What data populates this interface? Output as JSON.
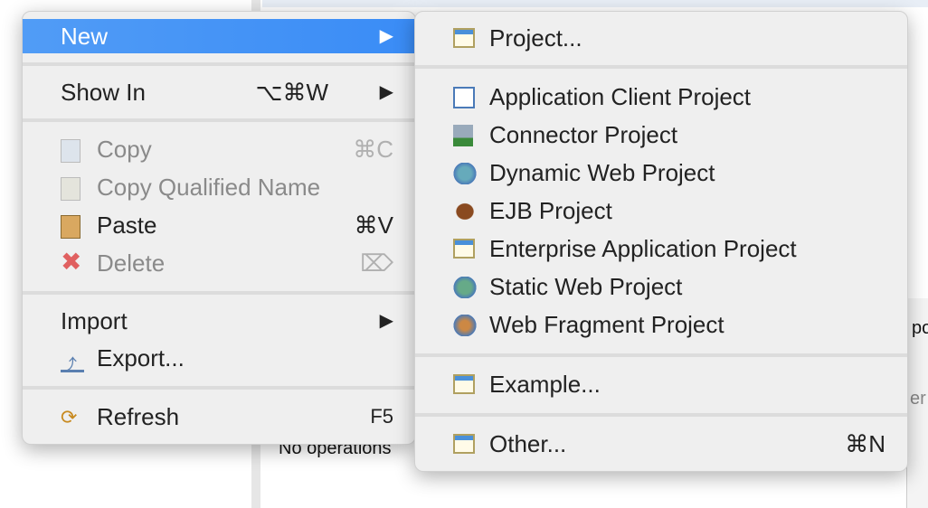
{
  "background": {
    "status_text": "No operations",
    "right_text_1": "po",
    "right_text_2": "er"
  },
  "context_menu": {
    "items": [
      {
        "label": "New",
        "shortcut": "",
        "submenu": true,
        "highlighted": true
      },
      {
        "label": "Show In",
        "shortcut": "⌥⌘W",
        "submenu": true
      },
      {
        "label": "Copy",
        "shortcut": "⌘C",
        "disabled": true,
        "icon": "copy-icon"
      },
      {
        "label": "Copy Qualified Name",
        "shortcut": "",
        "disabled": true,
        "icon": "copy-qualified-icon"
      },
      {
        "label": "Paste",
        "shortcut": "⌘V",
        "icon": "paste-icon"
      },
      {
        "label": "Delete",
        "shortcut": "⌦",
        "disabled": true,
        "icon": "delete-icon"
      },
      {
        "label": "Import",
        "submenu": true
      },
      {
        "label": "Export...",
        "icon": "export-icon"
      },
      {
        "label": "Refresh",
        "shortcut": "F5",
        "icon": "refresh-icon"
      }
    ]
  },
  "new_submenu": {
    "items": [
      {
        "label": "Project...",
        "icon": "project-wizard-icon"
      },
      {
        "label": "Application Client Project",
        "icon": "app-client-icon"
      },
      {
        "label": "Connector Project",
        "icon": "connector-icon"
      },
      {
        "label": "Dynamic Web Project",
        "icon": "dynamic-web-icon"
      },
      {
        "label": "EJB Project",
        "icon": "ejb-icon"
      },
      {
        "label": "Enterprise Application Project",
        "icon": "enterprise-app-icon"
      },
      {
        "label": "Static Web Project",
        "icon": "static-web-icon"
      },
      {
        "label": "Web Fragment Project",
        "icon": "web-fragment-icon"
      },
      {
        "label": "Example...",
        "icon": "example-wizard-icon"
      },
      {
        "label": "Other...",
        "shortcut": "⌘N",
        "icon": "other-wizard-icon"
      }
    ]
  },
  "colors": {
    "highlight": "#3a8cf6",
    "menu_bg": "#efefef"
  }
}
